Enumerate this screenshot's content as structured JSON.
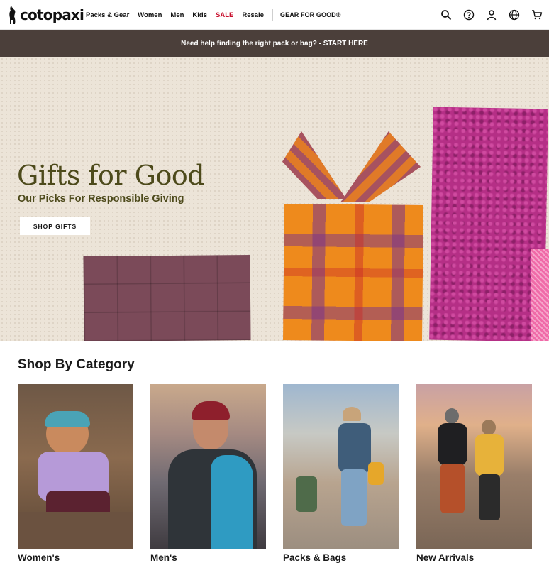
{
  "header": {
    "logo_text": "cotopaxi",
    "nav": [
      {
        "label": "Packs & Gear"
      },
      {
        "label": "Women"
      },
      {
        "label": "Men"
      },
      {
        "label": "Kids"
      },
      {
        "label": "SALE"
      },
      {
        "label": "Resale"
      },
      {
        "label": "GEAR FOR GOOD®"
      }
    ],
    "icons": [
      "search-icon",
      "help-icon",
      "account-icon",
      "globe-icon",
      "cart-icon"
    ]
  },
  "promo": {
    "text": "Need help finding the right pack or bag? - START HERE"
  },
  "hero": {
    "title": "Gifts for Good",
    "subtitle": "Our Picks For Responsible Giving",
    "cta": "SHOP GIFTS"
  },
  "categories": {
    "heading": "Shop By Category",
    "items": [
      {
        "label": "Women's"
      },
      {
        "label": "Men's"
      },
      {
        "label": "Packs & Bags"
      },
      {
        "label": "New Arrivals"
      }
    ]
  },
  "colors": {
    "promo_bg": "#4b3f3a",
    "hero_text": "#4d4a1b",
    "sale": "#c8102e"
  }
}
